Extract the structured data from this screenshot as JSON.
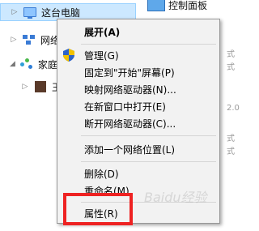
{
  "nav": {
    "items": [
      {
        "label": "这台电脑",
        "icon": "computer-icon",
        "selected": true
      },
      {
        "label": "网络",
        "icon": "network-icon"
      },
      {
        "label": "家庭组",
        "icon": "homegroup-icon"
      },
      {
        "label": "王",
        "icon": "user-avatar-icon"
      }
    ]
  },
  "right_panel": {
    "control_panel_label": "控制面板",
    "side_fragments": [
      "式",
      "式",
      "2.0",
      "式",
      "式"
    ]
  },
  "context_menu": {
    "items": [
      {
        "label": "展开(A)",
        "bold": true
      },
      {
        "label": "管理(G)",
        "icon": "uac-shield-icon"
      },
      {
        "label": "固定到\"开始\"屏幕(P)"
      },
      {
        "label": "映射网络驱动器(N)..."
      },
      {
        "label": "在新窗口中打开(E)"
      },
      {
        "label": "断开网络驱动器(C)..."
      },
      {
        "label": "添加一个网络位置(L)"
      },
      {
        "label": "删除(D)"
      },
      {
        "label": "重命名(M)"
      },
      {
        "label": "属性(R)"
      }
    ]
  },
  "annotation": {
    "highlight_color": "#ee2222"
  },
  "watermark": "Baidu经验"
}
